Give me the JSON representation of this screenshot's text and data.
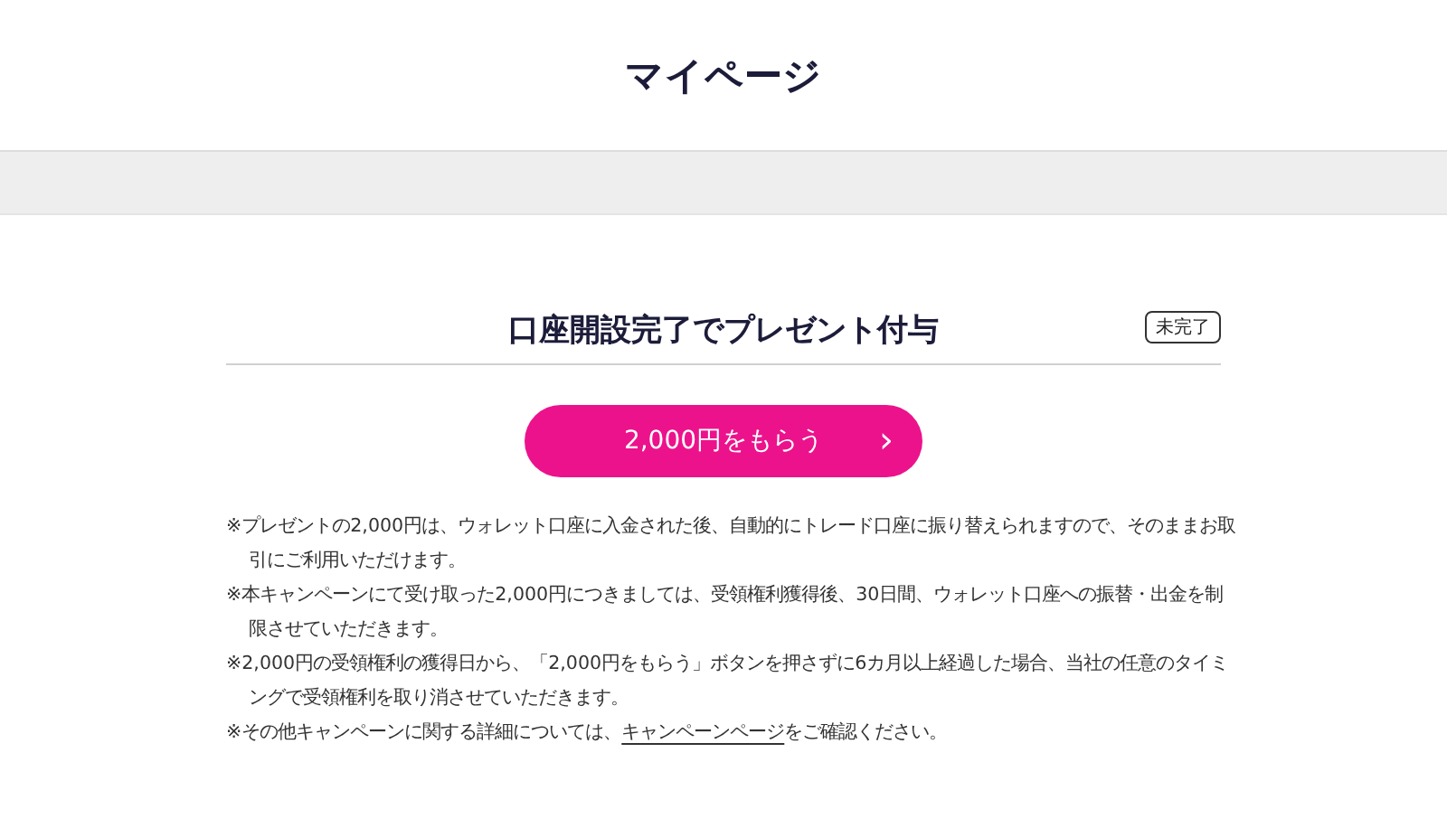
{
  "header": {
    "title": "マイページ"
  },
  "campaign": {
    "title": "口座開設完了でプレゼント付与",
    "status": "未完了",
    "button": {
      "label": "2,000円をもらう",
      "chevron": "›"
    }
  },
  "notes": [
    {
      "text": "※プレゼントの2,000円は、ウォレット口座に入金された後、自動的にトレード口座に振り替えられますので、そのままお取引にご利用いただけます。"
    },
    {
      "text": "※本キャンペーンにて受け取った2,000円につきましては、受領権利獲得後、30日間、ウォレット口座への振替・出金を制限させていただきます。"
    },
    {
      "text": "※2,000円の受領権利の獲得日から、「2,000円をもらう」ボタンを押さずに6カ月以上経過した場合、当社の任意のタイミングで受領権利を取り消させていただきます。"
    },
    {
      "text": "※その他キャンペーンに関する詳細については、",
      "link": "キャンペーンページ",
      "after": "をご確認ください。"
    }
  ]
}
